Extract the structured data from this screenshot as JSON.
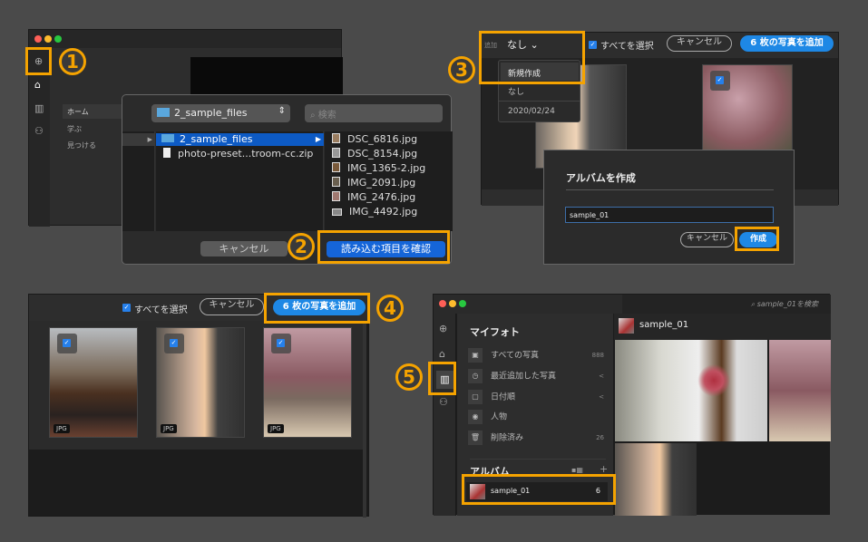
{
  "steps": {
    "s1": "1",
    "s2": "2",
    "s3": "3",
    "s4": "4",
    "s5": "5"
  },
  "colors": {
    "highlight": "#f5a300",
    "accent": "#1e88e5",
    "background": "#4a4a4a"
  },
  "panel1": {
    "nav": [
      "ホーム",
      "学ぶ",
      "見つける"
    ],
    "sidebar_icons": [
      "add-photo-icon",
      "home-icon",
      "library-icon",
      "people-icon"
    ],
    "dialog": {
      "location": "2_sample_files",
      "search_placeholder": "検索",
      "column1": [
        {
          "name": "2_sample_files",
          "type": "folder",
          "selected": true
        },
        {
          "name": "photo-preset...troom-cc.zip",
          "type": "file"
        }
      ],
      "column2": [
        "DSC_6816.jpg",
        "DSC_8154.jpg",
        "IMG_1365-2.jpg",
        "IMG_2091.jpg",
        "IMG_2476.jpg",
        "IMG_4492.jpg"
      ],
      "cancel": "キャンセル",
      "confirm": "読み込む項目を確認"
    }
  },
  "panel3": {
    "add_to_label": "追加",
    "album_select": "なし",
    "select_all": "すべてを選択",
    "cancel": "キャンセル",
    "add_button": "6 枚の写真を追加",
    "menu": [
      "新規作成",
      "なし",
      "2020/02/24"
    ],
    "dialog": {
      "title": "アルバムを作成",
      "input_value": "sample_01",
      "cancel": "キャンセル",
      "create": "作成"
    }
  },
  "panel4": {
    "select_all": "すべてを選択",
    "cancel": "キャンセル",
    "add_button": "6 枚の写真を追加",
    "badges": [
      "JPG",
      "JPG",
      "JPG"
    ]
  },
  "panel5": {
    "search_placeholder": "sample_01を検索",
    "my_photos": "マイフォト",
    "items": [
      {
        "label": "すべての写真",
        "count": "888"
      },
      {
        "label": "最近追加した写真",
        "count": "<"
      },
      {
        "label": "日付順",
        "count": "<"
      },
      {
        "label": "人物",
        "count": ""
      },
      {
        "label": "削除済み",
        "count": "26"
      }
    ],
    "albums_title": "アルバム",
    "album": {
      "name": "sample_01",
      "count": "6"
    },
    "header_title": "sample_01"
  }
}
